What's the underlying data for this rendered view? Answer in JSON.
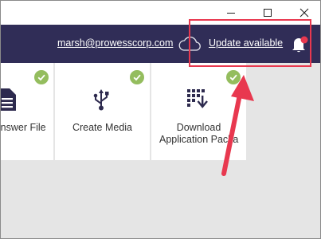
{
  "window": {
    "minimize_icon": "minimize-icon",
    "maximize_icon": "maximize-icon",
    "close_icon": "close-icon"
  },
  "header": {
    "background_color": "#302d57",
    "email": "marsh@prowesscorp.com",
    "cloud_icon": "cloud-icon",
    "update_label": "Update available",
    "bell_icon": "bell-icon",
    "notification_color": "#e8384f"
  },
  "tiles": [
    {
      "label": "Answer File",
      "icon": "document-icon",
      "status": "complete"
    },
    {
      "label": "Create Media",
      "icon": "usb-icon",
      "status": "complete"
    },
    {
      "label_line1": "Download",
      "label_line2": "Application Packa",
      "icon": "download-grid-icon",
      "status": "complete"
    }
  ],
  "check_color": "#94bd5e",
  "annotation": {
    "highlight_color": "#e8384f",
    "arrow_color": "#e8384f"
  }
}
